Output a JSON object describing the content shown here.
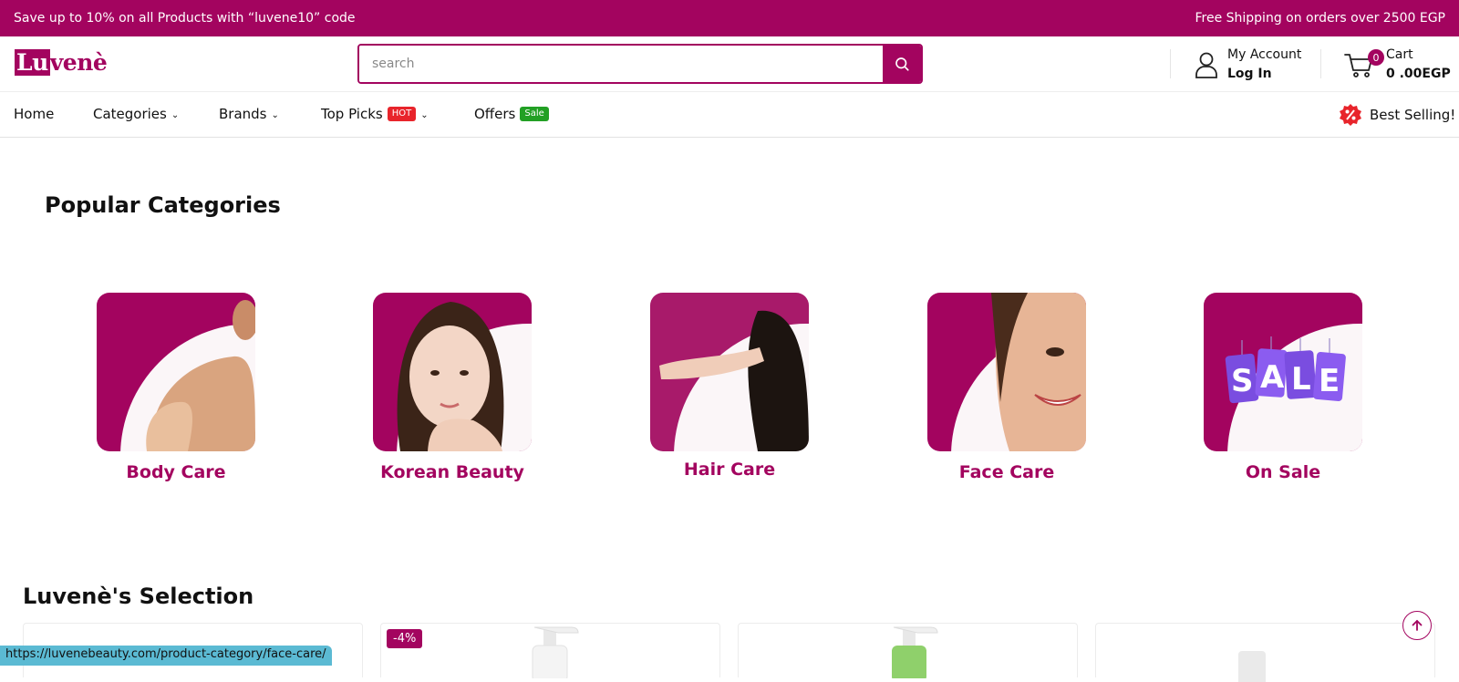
{
  "promo": {
    "left": "Save up to 10% on all Products with “luvene10” code",
    "right": "Free Shipping on orders over 2500 EGP"
  },
  "header": {
    "logo_text": "Luvenè",
    "search_placeholder": "search",
    "account_line1": "My Account",
    "account_line2": "Log In",
    "cart_label": "Cart",
    "cart_total": "0 .00EGP",
    "cart_count": "0"
  },
  "nav": {
    "home": "Home",
    "categories": "Categories",
    "brands": "Brands",
    "top_picks": "Top Picks",
    "top_picks_badge": "HOT",
    "offers": "Offers",
    "offers_badge": "Sale",
    "best_selling": "Best Selling!"
  },
  "popular": {
    "title": "Popular Categories",
    "items": [
      {
        "label": "Body Care",
        "icon": "body-care-image"
      },
      {
        "label": "Korean Beauty",
        "icon": "korean-beauty-image"
      },
      {
        "label": "Hair Care",
        "icon": "hair-care-image"
      },
      {
        "label": "Face Care",
        "icon": "face-care-image"
      },
      {
        "label": "On Sale",
        "icon": "sale-tags-image"
      }
    ]
  },
  "selection": {
    "title": "Luvenè's Selection",
    "discount_badge": "-4%"
  },
  "status_url": "https://luvenebeauty.com/product-category/face-care/",
  "colors": {
    "brand": "#a3045f",
    "hot_badge": "#e8242b",
    "sale_badge": "#22a024"
  }
}
